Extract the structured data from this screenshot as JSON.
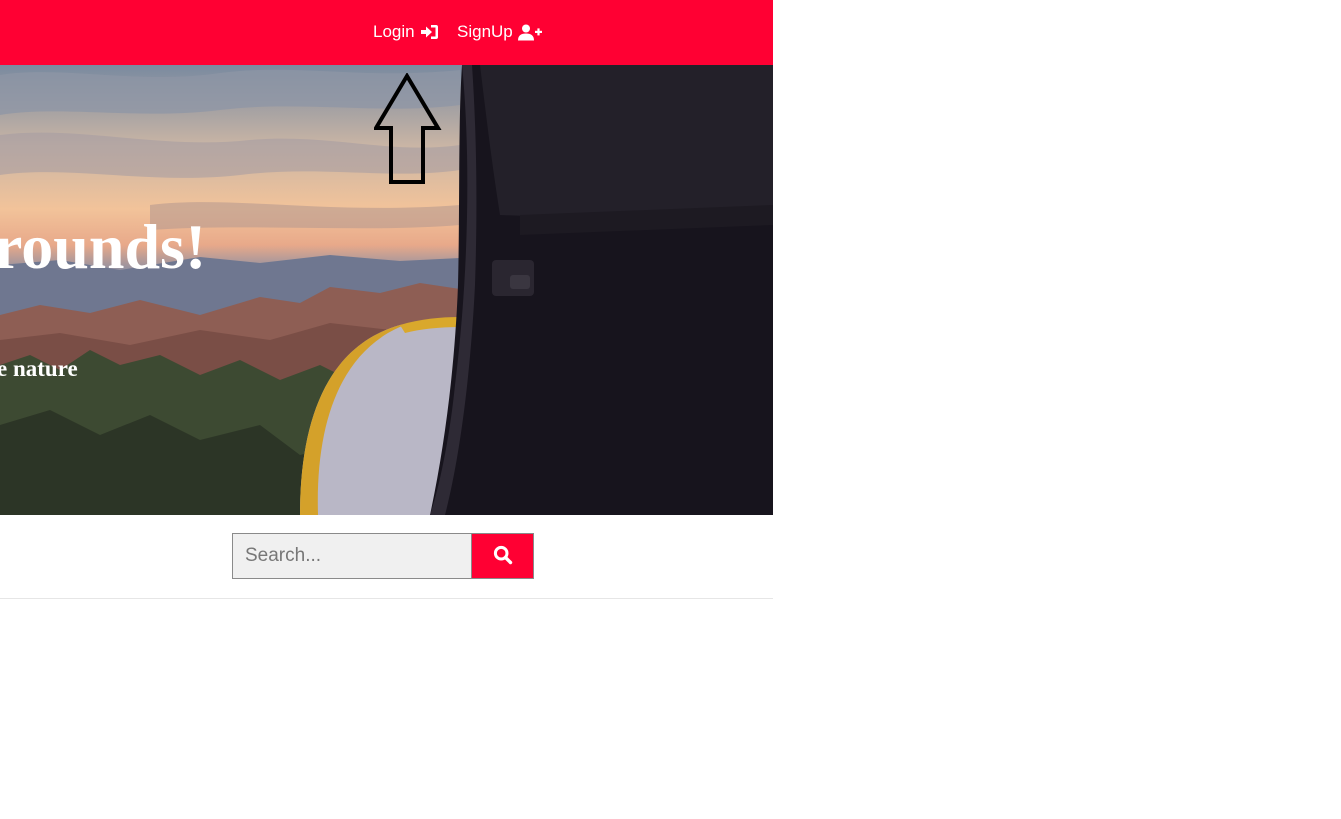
{
  "nav": {
    "login_label": "Login",
    "login_icon": "sign-in-icon",
    "signup_label": "SignUp",
    "signup_icon": "user-plus-icon"
  },
  "hero": {
    "title": "rounds!",
    "subtitle": "e nature"
  },
  "search": {
    "placeholder": "Search...",
    "button_icon": "search-icon"
  },
  "colors": {
    "brand": "#ff0033",
    "nav_text": "#ffffff",
    "search_bg": "#f0f0f0"
  }
}
